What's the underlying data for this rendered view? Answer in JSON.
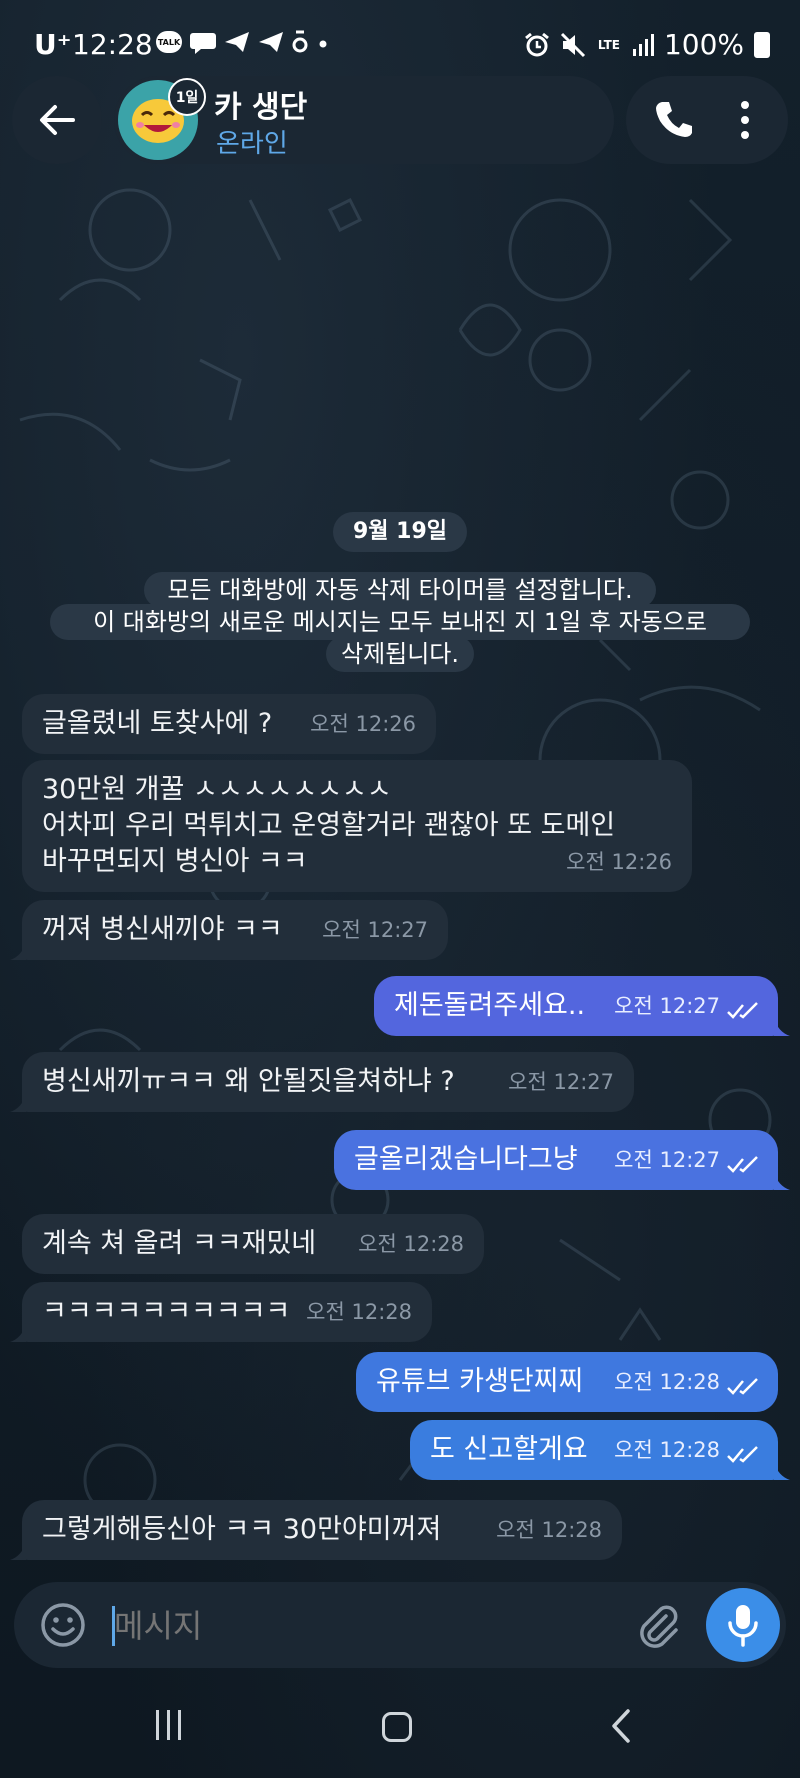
{
  "status_bar": {
    "carrier": "U⁺",
    "time": "12:28",
    "network": "LTE",
    "battery": "100%",
    "left_icons": [
      "talk-bubble-icon",
      "chat-bubble-icon",
      "telegram-icon",
      "telegram-icon",
      "notification-icon",
      "dot-icon"
    ],
    "right_icons": [
      "alarm-icon",
      "mute-icon",
      "lte-icon",
      "signal-icon",
      "battery-icon"
    ]
  },
  "header": {
    "chat_name": "카 생단",
    "status": "온라인",
    "timer_badge": "1일"
  },
  "date_chip": "9월 19일",
  "service_message": [
    "모든 대화방에 자동 삭제 타이머를 설정합니다.",
    "이 대화방의 새로운 메시지는 모두 보내진 지 1일 후 자동으로",
    "삭제됩니다."
  ],
  "messages": [
    {
      "dir": "in",
      "text": "글올렸네 토찾사에 ?",
      "time": "오전 12:26"
    },
    {
      "dir": "in",
      "text": "30만원 개꿀 ㅅㅅㅅㅅㅅㅅㅅㅅ\n어차피 우리 먹튀치고 운영할거라 괜찮아 또 도메인\n바꾸면되지 병신아 ㅋㅋ",
      "time": "오전 12:26"
    },
    {
      "dir": "in",
      "text": "꺼져 병신새끼야 ㅋㅋ",
      "time": "오전 12:27"
    },
    {
      "dir": "out",
      "text": "제돈돌려주세요..",
      "time": "오전 12:27",
      "read": true
    },
    {
      "dir": "in",
      "text": "병신새끼ㅠㅋㅋ 왜 안될짓을쳐하냐 ?",
      "time": "오전 12:27"
    },
    {
      "dir": "out",
      "text": "글올리겠습니다그냥",
      "time": "오전 12:27",
      "read": true
    },
    {
      "dir": "in",
      "text": "계속 쳐 올려 ㅋㅋ재밌네",
      "time": "오전 12:28"
    },
    {
      "dir": "in",
      "text": "ㅋㅋㅋㅋㅋㅋㅋㅋㅋㅋ",
      "time": "오전 12:28"
    },
    {
      "dir": "out",
      "text": "유튜브 카생단찌찌",
      "time": "오전 12:28",
      "read": true
    },
    {
      "dir": "out",
      "text": "도 신고할게요",
      "time": "오전 12:28",
      "read": true
    },
    {
      "dir": "in",
      "text": "그렇게해등신아 ㅋㅋ 30만야미꺼져",
      "time": "오전 12:28"
    }
  ],
  "input": {
    "placeholder": "메시지",
    "value": ""
  },
  "colors": {
    "background": "#0f1a24",
    "incoming_bubble": "#222e3a",
    "outgoing_bubble": "#4e6fe0",
    "accent": "#5fa8e8",
    "mic_button": "#3b8ee8"
  }
}
